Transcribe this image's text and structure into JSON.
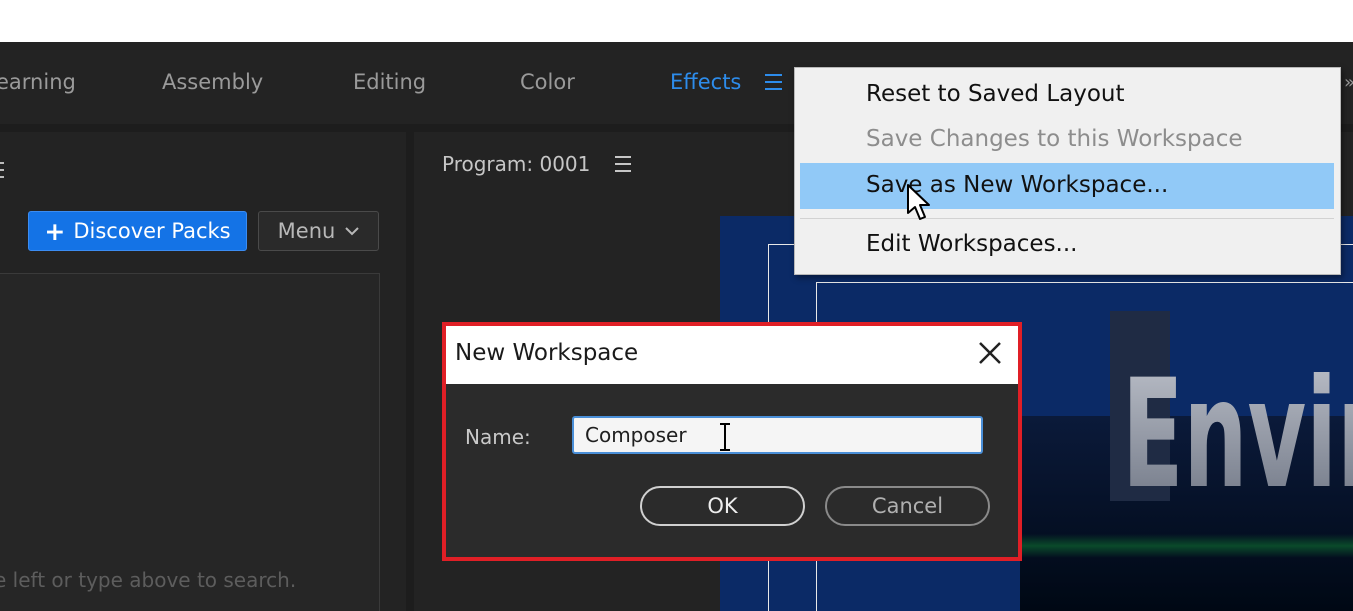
{
  "workspace_tabs": {
    "items": [
      {
        "label": "earning"
      },
      {
        "label": "Assembly"
      },
      {
        "label": "Editing"
      },
      {
        "label": "Color"
      },
      {
        "label": "Effects"
      }
    ],
    "active": "Effects",
    "menu_icon": "hamburger-icon"
  },
  "left_panel": {
    "discover_button": "Discover Packs",
    "discover_icon": "plus-icon",
    "menu_button": "Menu",
    "menu_icon": "chevron-down-icon",
    "hint": "e left or type above to search."
  },
  "program_panel": {
    "title": "Program: 0001",
    "menu_icon": "hamburger-icon",
    "video_text": "Environ"
  },
  "workspace_menu": {
    "items": [
      {
        "label": "Reset to Saved Layout",
        "enabled": true
      },
      {
        "label": "Save Changes to this Workspace",
        "enabled": false
      },
      {
        "label": "Save as New Workspace...",
        "enabled": true,
        "highlighted": true
      },
      {
        "label": "Edit Workspaces...",
        "enabled": true
      }
    ]
  },
  "dialog": {
    "title": "New Workspace",
    "name_label": "Name:",
    "name_value": "Composer",
    "ok_label": "OK",
    "cancel_label": "Cancel",
    "close_icon": "close-icon"
  },
  "colors": {
    "accent": "#2d8ceb",
    "highlight": "#91c9f7",
    "annotation_outline": "#e01f26",
    "discover_button": "#1473e6"
  }
}
